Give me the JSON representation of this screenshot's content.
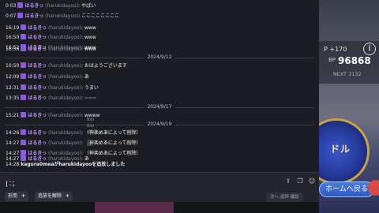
{
  "messages": [
    {
      "time": "0:03",
      "name": "はるきっ",
      "handle": "(harukidayoo)",
      "text": "やばい"
    },
    {
      "time": "0:07",
      "name": "はるきっ",
      "handle": "(harukidayoo)",
      "text": "ここここここここ"
    },
    {
      "time": "16:19",
      "name": "はるきっ",
      "handle": "(harukidayoo)",
      "text": "www"
    },
    {
      "time": "16:50",
      "name": "はるきっ",
      "handle": "(harukidayoo)",
      "text": "www"
    },
    {
      "time": "16:52",
      "name": "はるきっ",
      "handle": "(harukidayoo)",
      "text": "www"
    },
    {
      "time": "16:56",
      "name": "はるきっ",
      "handle": "(harukidayoo)",
      "text": "www"
    },
    {
      "time": "10:50",
      "name": "はるきっ",
      "handle": "(harukidayoo)",
      "text": "おはようございます"
    },
    {
      "time": "12:09",
      "name": "はるきっ",
      "handle": "(harukidayoo)",
      "text": "あ"
    },
    {
      "time": "12:31",
      "name": "はるきっ",
      "handle": "(harukidayoo)",
      "text": "うまい"
    },
    {
      "time": "13:35",
      "name": "はるきっ",
      "handle": "(harukidayoo)",
      "text": "~~~"
    },
    {
      "time": "15:21",
      "name": "はるきっ",
      "handle": "(harukidayoo)",
      "text": "wwww"
    },
    {
      "time": "14:26",
      "name": "はるきっ",
      "handle": "(harukidayoo)",
      "text": "（神楽めあによって削除）"
    },
    {
      "time": "14:27",
      "name": "はるきっ",
      "handle": "(harukidayoo)",
      "text": "（神楽めあによって削除）"
    },
    {
      "time": "14:27",
      "name": "はるきっ",
      "handle": "(harukidayoo)",
      "text": "（神楽めあによって削除）"
    },
    {
      "time": "14:27",
      "name": "はるきっ",
      "handle": "(harukidayoo)",
      "text": "あ"
    }
  ],
  "system_message": {
    "time": "14:28",
    "text": "kagura0meaがharukidayooを追放しました"
  },
  "date_separators": [
    "2024/9/12",
    "2024/9/17",
    "2024/9/19"
  ],
  "overlay_labels": [
    "Bibi",
    "Bibi",
    "eTh",
    "..",
    "sin"
  ],
  "input": {
    "value": "|：；"
  },
  "toolbar": {
    "chip_1": "形而",
    "chip_2": "追放を解除",
    "next_label": "次へ 返辞 確認"
  },
  "game": {
    "lp": "P +170",
    "bp_label": "BP",
    "bp_value": "96868",
    "next": "NEXT 3132",
    "orb_label": "ドル",
    "home_button": "ホームへ戻る",
    "info_icon": "i"
  }
}
